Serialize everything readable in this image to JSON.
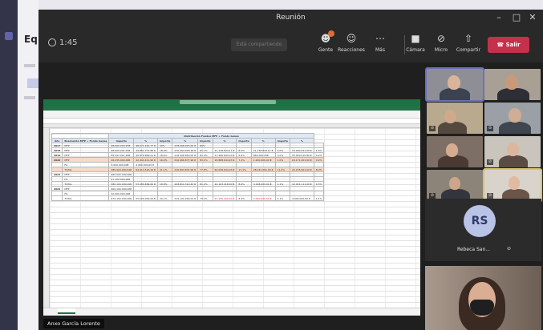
{
  "background_app": {
    "title": "Eq"
  },
  "window": {
    "title": "Reunión",
    "controls": {
      "minimize": "–",
      "maximize": "□",
      "close": "✕"
    }
  },
  "toolbar": {
    "timer": "1:45",
    "share_notice": "Está compartiendo",
    "buttons": [
      {
        "id": "people",
        "label": "Gente",
        "icon": "people-icon"
      },
      {
        "id": "reactions",
        "label": "Reacciones",
        "icon": "reactions-icon"
      },
      {
        "id": "more",
        "label": "Más",
        "icon": "more-icon"
      },
      {
        "id": "camera",
        "label": "Cámara",
        "icon": "camera-icon"
      },
      {
        "id": "mic",
        "label": "Micro",
        "icon": "mic-icon"
      },
      {
        "id": "share",
        "label": "Compartir",
        "icon": "share-icon"
      }
    ],
    "leave_label": "Salir",
    "colors": {
      "leave": "#c4314b",
      "accent": "#6264a7",
      "badge": "#e06b36"
    }
  },
  "shared_screen": {
    "presenter_name": "Anxo García Lorente",
    "spreadsheet": {
      "table_title": "Distribución Fondos MFP + Fondo Genes",
      "headers": [
        "Año",
        "Resolución MFP + Fondo Genes",
        "Importe",
        "%",
        "Importe",
        "%",
        "Importe",
        "%",
        "Importe",
        "%",
        "Importe",
        "%"
      ],
      "rows": [
        {
          "year": "2017",
          "type": "MFP",
          "values": [
            "28.000.203,97€",
            "48.071.261,77 €",
            "20%",
            "278.998.915,00 €",
            "80%",
            "",
            "",
            "",
            "",
            "",
            ""
          ],
          "highlight": false
        },
        {
          "year": "2018",
          "type": "MFP",
          "values": [
            "28.000.201,97€",
            "49.861.707,86 €",
            "18,9%",
            "270.494.918,38 €",
            "81,1%",
            "21.118.844,11 €",
            "8,5%",
            "21.118.844,11 €",
            "3,0%",
            "13.000.221,00 €",
            "1,9%"
          ],
          "highlight": false
        },
        {
          "year": "2019",
          "type": "MFP",
          "values": [
            "26.447.001,26€",
            "40.876.869,01 €",
            "18,6%",
            "218.408.850,00 €",
            "81,4%",
            "17.466.843,03 €",
            "6,9%",
            "880.000,20€",
            "3,0%",
            "15.990.010,80 €",
            "0,9%"
          ],
          "highlight": false
        },
        {
          "year": "2020",
          "type": "MFP",
          "values": [
            "26.235.000,00€",
            "42.404.411,90 €",
            "16,9%",
            "216.466.677,96 €",
            "83,1%",
            "18.888.644,93 €",
            "7,1%",
            "1.200.000,00 €",
            "1,0%",
            "24.171.201,00 €",
            "0,9%"
          ],
          "highlight": true
        },
        {
          "year": "",
          "type": "FG",
          "values": [
            "3.000.000,00€",
            "4.060.000,00 €",
            "",
            "",
            "",
            "",
            "",
            "",
            "",
            "",
            ""
          ],
          "highlight": false
        },
        {
          "year": "",
          "type": "TOTAL",
          "values": [
            "280.994.990,61€",
            "64.914.516,44 €",
            "21,1%",
            "216.894.897,96 €",
            "77,8%",
            "60.028.944,03 €",
            "17,1%",
            "28.041.661,00 €",
            "11,4%",
            "22.155.901,00 €",
            "8,0%"
          ],
          "highlight": true
        },
        {
          "year": "2021",
          "type": "MFP",
          "values": [
            "265.000.000,00€",
            "",
            "",
            "",
            "",
            "",
            "",
            "",
            "",
            "",
            ""
          ],
          "highlight": false
        },
        {
          "year": "",
          "type": "FG",
          "values": [
            "17.100.000,00€",
            "",
            "",
            "",
            "",
            "",
            "",
            "",
            "",
            "",
            ""
          ],
          "highlight": false
        },
        {
          "year": "",
          "type": "TOTAL",
          "values": [
            "282.100.000,00€",
            "53.289.689,60 €",
            "18,8%",
            "228.810.310,40 €",
            "81,2%",
            "24.163.418,00 €",
            "8,6%",
            "3.168.000,00 €",
            "1,1%",
            "12.001.111,00 €",
            "4,3%"
          ],
          "highlight": false
        },
        {
          "year": "2022",
          "type": "MFP",
          "values": [
            "264.100.000,00€",
            "",
            "",
            "",
            "",
            "",
            "",
            "",
            "",
            "",
            ""
          ],
          "highlight": false
        },
        {
          "year": "",
          "type": "FG",
          "values": [
            "10.000.000,00€",
            "",
            "",
            "",
            "",
            "",
            "",
            "",
            "",
            "",
            ""
          ],
          "highlight": false
        },
        {
          "year": "",
          "type": "TOTAL",
          "values": [
            "274.100.000,00€",
            "55.000.000,00 €",
            "20,1%",
            "219.100.000,00 €",
            "79,9%",
            "23.100.000,00 €",
            "8,4%",
            "3.000.000,00 €",
            "1,1%",
            "3.000.000,00 €",
            "1,1%"
          ],
          "highlight": false,
          "red_cols": [
            5,
            7
          ]
        }
      ]
    }
  },
  "participants": {
    "avatar_initials": "RS",
    "avatar_name": "Rebeca San...",
    "avatar_color": "#b9c3e6"
  }
}
